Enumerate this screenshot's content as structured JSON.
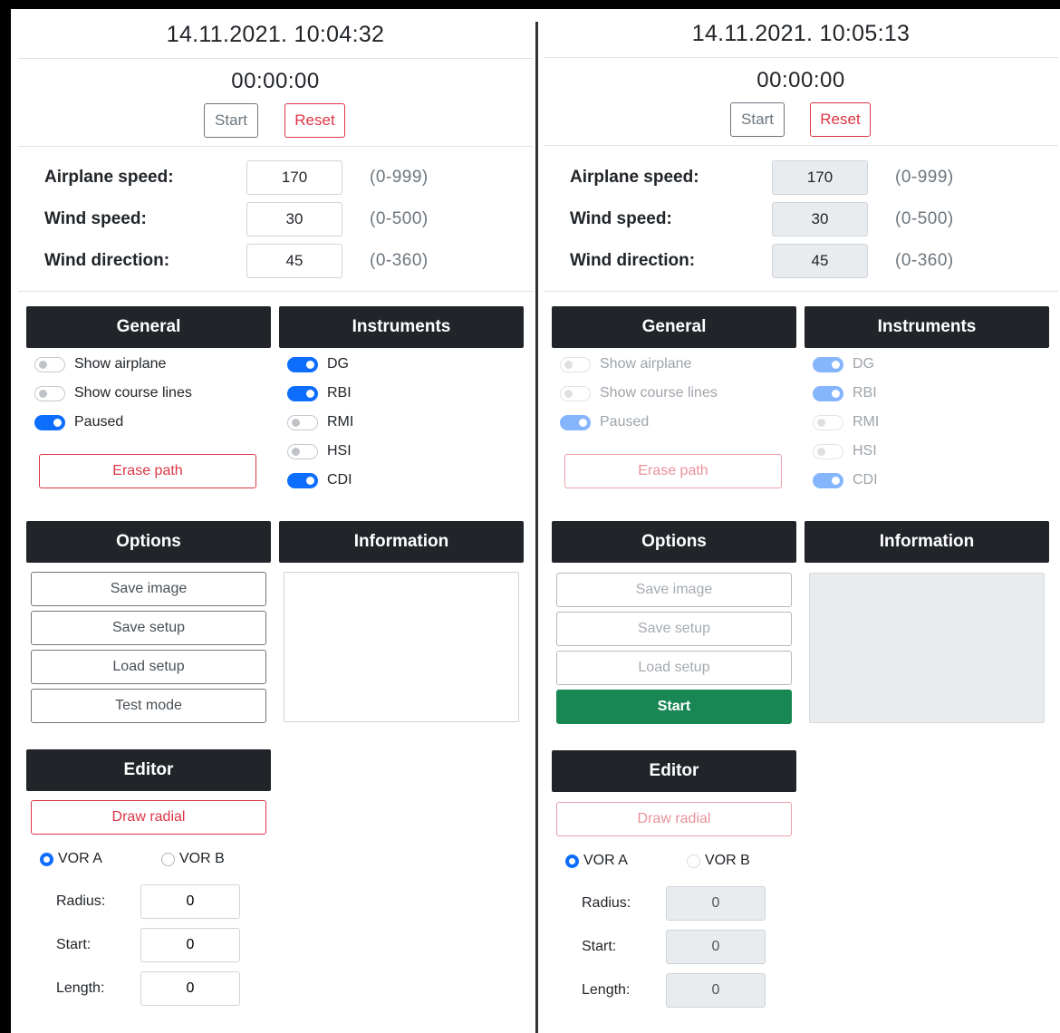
{
  "left": {
    "datetime": "14.11.2021. 10:04:32",
    "timer": "00:00:00",
    "start_label": "Start",
    "reset_label": "Reset",
    "params": [
      {
        "label": "Airplane speed:",
        "value": "170",
        "range": "(0-999)"
      },
      {
        "label": "Wind speed:",
        "value": "30",
        "range": "(0-500)"
      },
      {
        "label": "Wind direction:",
        "value": "45",
        "range": "(0-360)"
      }
    ],
    "general": {
      "header": "General",
      "switches": [
        {
          "label": "Show airplane",
          "on": false
        },
        {
          "label": "Show course lines",
          "on": false
        },
        {
          "label": "Paused",
          "on": true
        }
      ],
      "erase_label": "Erase path"
    },
    "instruments": {
      "header": "Instruments",
      "switches": [
        {
          "label": "DG",
          "on": true
        },
        {
          "label": "RBI",
          "on": true
        },
        {
          "label": "RMI",
          "on": false
        },
        {
          "label": "HSI",
          "on": false
        },
        {
          "label": "CDI",
          "on": true
        }
      ]
    },
    "options": {
      "header": "Options",
      "buttons": [
        "Save image",
        "Save setup",
        "Load setup",
        "Test mode"
      ]
    },
    "information": {
      "header": "Information"
    },
    "editor": {
      "header": "Editor",
      "draw_label": "Draw radial",
      "radios": [
        {
          "label": "VOR A",
          "on": true
        },
        {
          "label": "VOR B",
          "on": false
        }
      ],
      "fields": [
        {
          "label": "Radius:",
          "value": "0"
        },
        {
          "label": "Start:",
          "value": "0"
        },
        {
          "label": "Length:",
          "value": "0"
        }
      ]
    }
  },
  "right": {
    "datetime": "14.11.2021. 10:05:13",
    "timer": "00:00:00",
    "start_label": "Start",
    "reset_label": "Reset",
    "params": [
      {
        "label": "Airplane speed:",
        "value": "170",
        "range": "(0-999)"
      },
      {
        "label": "Wind speed:",
        "value": "30",
        "range": "(0-500)"
      },
      {
        "label": "Wind direction:",
        "value": "45",
        "range": "(0-360)"
      }
    ],
    "general": {
      "header": "General",
      "switches": [
        {
          "label": "Show airplane",
          "on": false
        },
        {
          "label": "Show course lines",
          "on": false
        },
        {
          "label": "Paused",
          "on": true
        }
      ],
      "erase_label": "Erase path"
    },
    "instruments": {
      "header": "Instruments",
      "switches": [
        {
          "label": "DG",
          "on": true
        },
        {
          "label": "RBI",
          "on": true
        },
        {
          "label": "RMI",
          "on": false
        },
        {
          "label": "HSI",
          "on": false
        },
        {
          "label": "CDI",
          "on": true
        }
      ]
    },
    "options": {
      "header": "Options",
      "buttons": [
        "Save image",
        "Save setup",
        "Load setup"
      ],
      "start_label": "Start"
    },
    "information": {
      "header": "Information"
    },
    "editor": {
      "header": "Editor",
      "draw_label": "Draw radial",
      "radios": [
        {
          "label": "VOR A",
          "on": true
        },
        {
          "label": "VOR B",
          "on": false
        }
      ],
      "fields": [
        {
          "label": "Radius:",
          "value": "0"
        },
        {
          "label": "Start:",
          "value": "0"
        },
        {
          "label": "Length:",
          "value": "0"
        }
      ]
    }
  },
  "colors": {
    "dark_header": "#212529",
    "danger": "#dc3545",
    "primary": "#0d6efd",
    "success": "#198754",
    "disabled_bg": "#e9ecef"
  }
}
